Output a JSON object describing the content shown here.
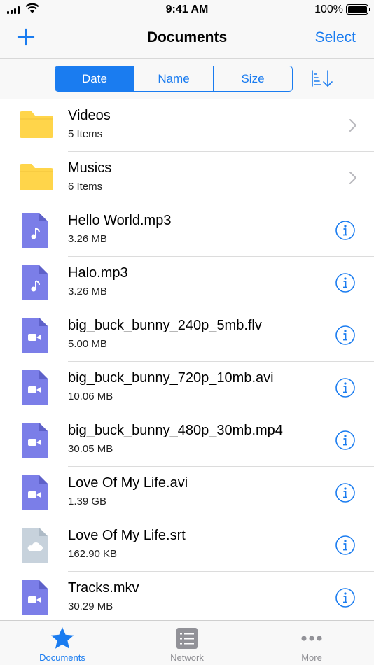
{
  "status_bar": {
    "time": "9:41 AM",
    "battery": "100%"
  },
  "nav": {
    "title": "Documents",
    "select_label": "Select",
    "add_icon": "plus-icon"
  },
  "sort": {
    "segments": [
      {
        "label": "Date",
        "active": true
      },
      {
        "label": "Name",
        "active": false
      },
      {
        "label": "Size",
        "active": false
      }
    ],
    "order_icon": "sort-descending-icon"
  },
  "colors": {
    "accent": "#1a7cf0",
    "folder": "#ffd54a",
    "media_file": "#7b7ee8",
    "subtitle_file": "#c7d2dc"
  },
  "files": [
    {
      "name": "Videos",
      "meta": "5 Items",
      "kind": "folder",
      "accessory": "chevron"
    },
    {
      "name": "Musics",
      "meta": "6 Items",
      "kind": "folder",
      "accessory": "chevron"
    },
    {
      "name": "Hello World.mp3",
      "meta": "3.26 MB",
      "kind": "audio",
      "accessory": "info"
    },
    {
      "name": "Halo.mp3",
      "meta": "3.26 MB",
      "kind": "audio",
      "accessory": "info"
    },
    {
      "name": "big_buck_bunny_240p_5mb.flv",
      "meta": "5.00 MB",
      "kind": "video",
      "accessory": "info"
    },
    {
      "name": "big_buck_bunny_720p_10mb.avi",
      "meta": "10.06 MB",
      "kind": "video",
      "accessory": "info"
    },
    {
      "name": "big_buck_bunny_480p_30mb.mp4",
      "meta": "30.05 MB",
      "kind": "video",
      "accessory": "info"
    },
    {
      "name": "Love Of My Life.avi",
      "meta": "1.39 GB",
      "kind": "video",
      "accessory": "info"
    },
    {
      "name": "Love Of My Life.srt",
      "meta": "162.90 KB",
      "kind": "subtitle",
      "accessory": "info"
    },
    {
      "name": "Tracks.mkv",
      "meta": "30.29 MB",
      "kind": "video",
      "accessory": "info"
    }
  ],
  "tabs": [
    {
      "label": "Documents",
      "icon": "star-icon",
      "active": true
    },
    {
      "label": "Network",
      "icon": "list-icon",
      "active": false
    },
    {
      "label": "More",
      "icon": "more-icon",
      "active": false
    }
  ]
}
